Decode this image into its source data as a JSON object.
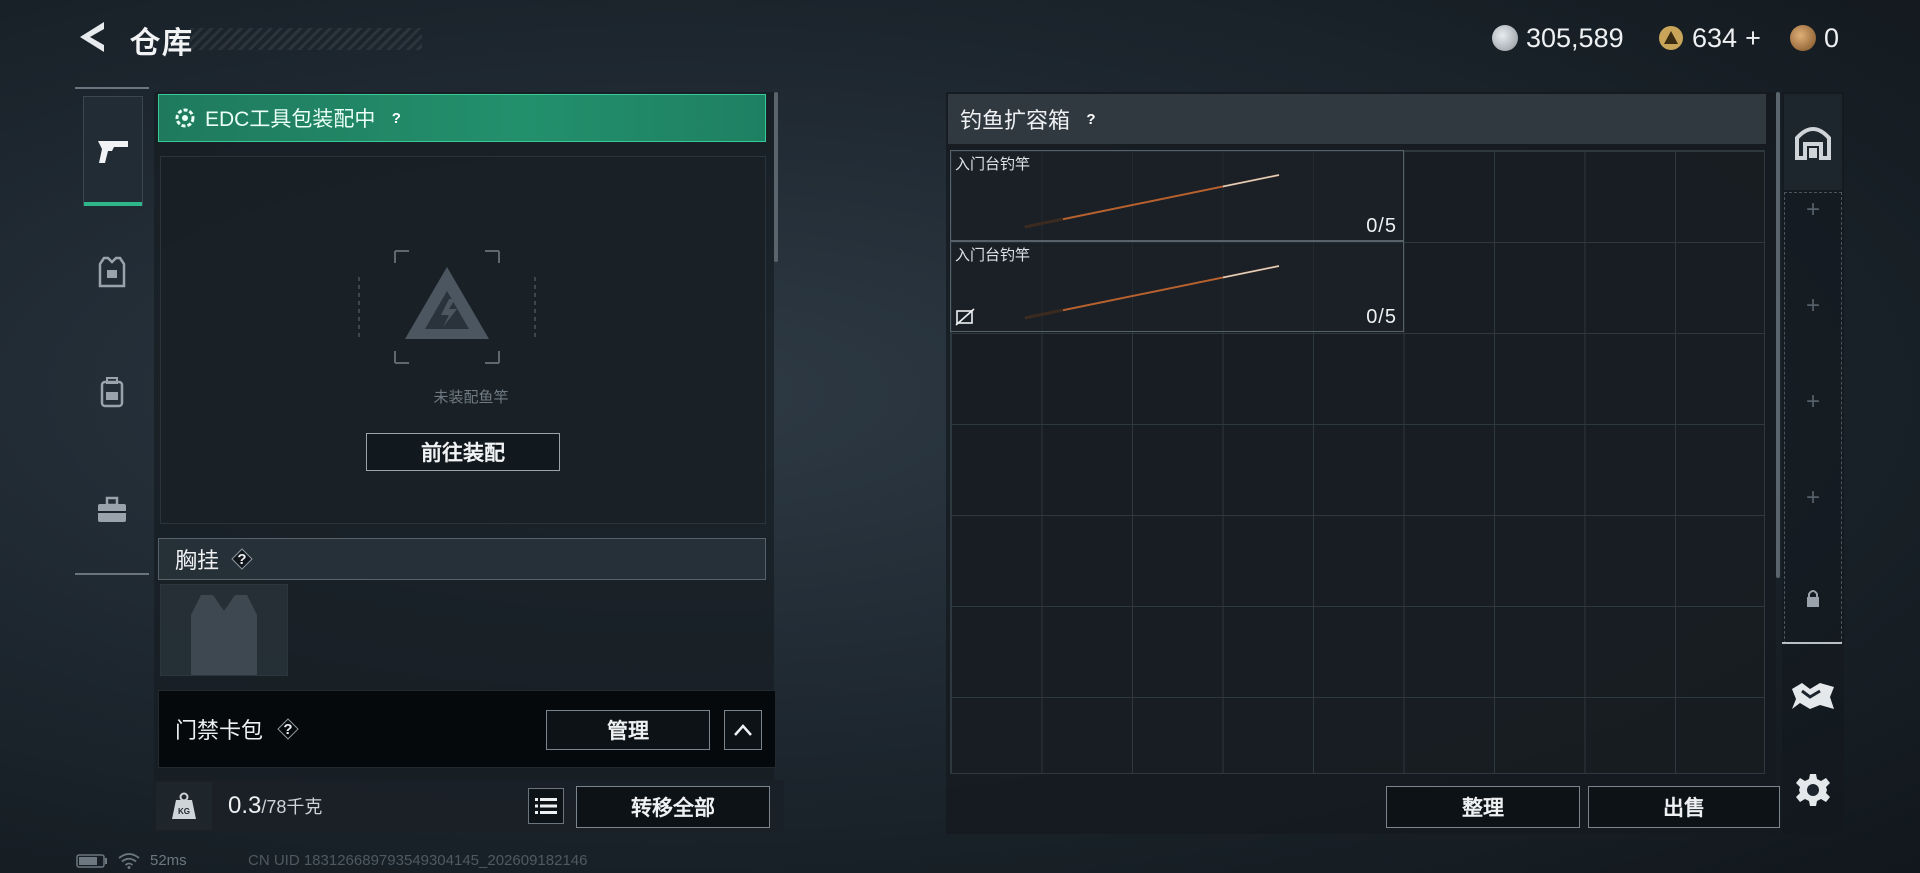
{
  "header": {
    "title": "仓库",
    "currencies": [
      {
        "icon": "silver-coin-icon",
        "value": "305,589",
        "color": "#c9ced3"
      },
      {
        "icon": "gold-triangle-coin-icon",
        "value": "634",
        "suffix": "+",
        "color": "#c8a558"
      },
      {
        "icon": "bronze-coin-icon",
        "value": "0",
        "color": "#b9874a"
      }
    ]
  },
  "left_nav": {
    "items": [
      {
        "icon": "pistol-icon",
        "active": true
      },
      {
        "icon": "armor-vest-icon",
        "active": false
      },
      {
        "icon": "backpack-icon",
        "active": false
      },
      {
        "icon": "toolbox-icon",
        "active": false
      }
    ]
  },
  "loadout": {
    "edc_label": "EDC工具包装配中",
    "help": "?",
    "empty_label": "未装配鱼竿",
    "goto_button": "前往装配",
    "chest_rig_label": "胸挂",
    "keycard_label": "门禁卡包",
    "manage_button": "管理"
  },
  "weight": {
    "current": "0.3",
    "capacity": "/78千克",
    "transfer_button": "转移全部"
  },
  "fishing_box": {
    "title": "钓鱼扩容箱",
    "help": "?",
    "items": [
      {
        "name": "入门台钓竿",
        "count": "0/5",
        "broken": false
      },
      {
        "name": "入门台钓竿",
        "count": "0/5",
        "broken": true
      }
    ],
    "sort_button": "整理",
    "sell_button": "出售"
  },
  "right_nav": {
    "slot_add_symbol": "+",
    "icons": [
      "stash-icon",
      "lock-icon",
      "map-icon",
      "settings-gear-icon"
    ]
  },
  "status_bar": {
    "ping": "52ms",
    "uid": "CN UID 1831266897935493041​45_2026091​82146"
  },
  "colors": {
    "accent_green": "#23906c",
    "panel_dark": "#161d23",
    "border_light": "#7b858d"
  }
}
